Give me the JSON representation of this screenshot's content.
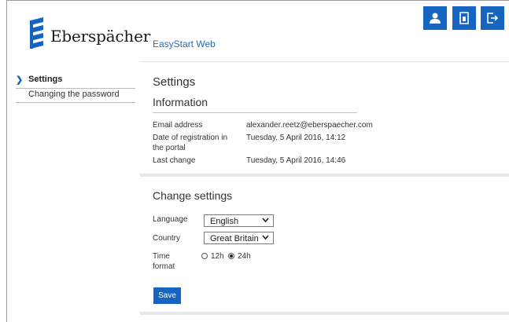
{
  "header": {
    "brand": "Eberspächer",
    "app_name": "EasyStart Web",
    "buttons": [
      "user-icon",
      "address-book-icon",
      "logout-icon"
    ],
    "accent_color": "#1565c0"
  },
  "sidebar": {
    "items": [
      {
        "label": "Settings",
        "active": true
      },
      {
        "label": "Changing the password",
        "active": false
      }
    ]
  },
  "main": {
    "title": "Settings",
    "information": {
      "title": "Information",
      "rows": [
        {
          "label": "Email address",
          "value": "alexander.reetz@eberspaecher.com"
        },
        {
          "label": "Date of registration in the portal",
          "value": "Tuesday, 5 April 2016, 14:12"
        },
        {
          "label": "Last change",
          "value": "Tuesday, 5 April 2016, 14:46"
        }
      ]
    },
    "change_settings": {
      "title": "Change settings",
      "language": {
        "label": "Language",
        "value": "English"
      },
      "country": {
        "label": "Country",
        "value": "Great Britain"
      },
      "time_format": {
        "label": "Time format",
        "options": [
          "12h",
          "24h"
        ],
        "selected": "24h"
      },
      "save_label": "Save"
    }
  }
}
